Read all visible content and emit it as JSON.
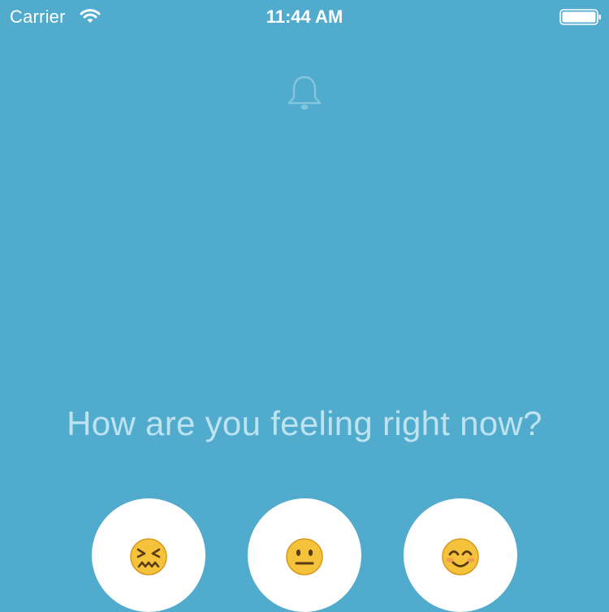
{
  "status_bar": {
    "carrier": "Carrier",
    "time": "11:44 AM",
    "icons": [
      "wifi-icon",
      "battery-icon"
    ]
  },
  "header": {
    "icon": "bell-icon"
  },
  "main": {
    "question": "How are you feeling right now?",
    "moods": [
      {
        "name": "upset",
        "icon": "confounded-face-icon"
      },
      {
        "name": "neutral",
        "icon": "neutral-face-icon"
      },
      {
        "name": "happy",
        "icon": "smiling-face-icon"
      }
    ]
  },
  "colors": {
    "background": "#51abcd",
    "question_text": "#bde3f1",
    "button": "#ffffff",
    "emoji_yellow": "#f5c33b"
  }
}
